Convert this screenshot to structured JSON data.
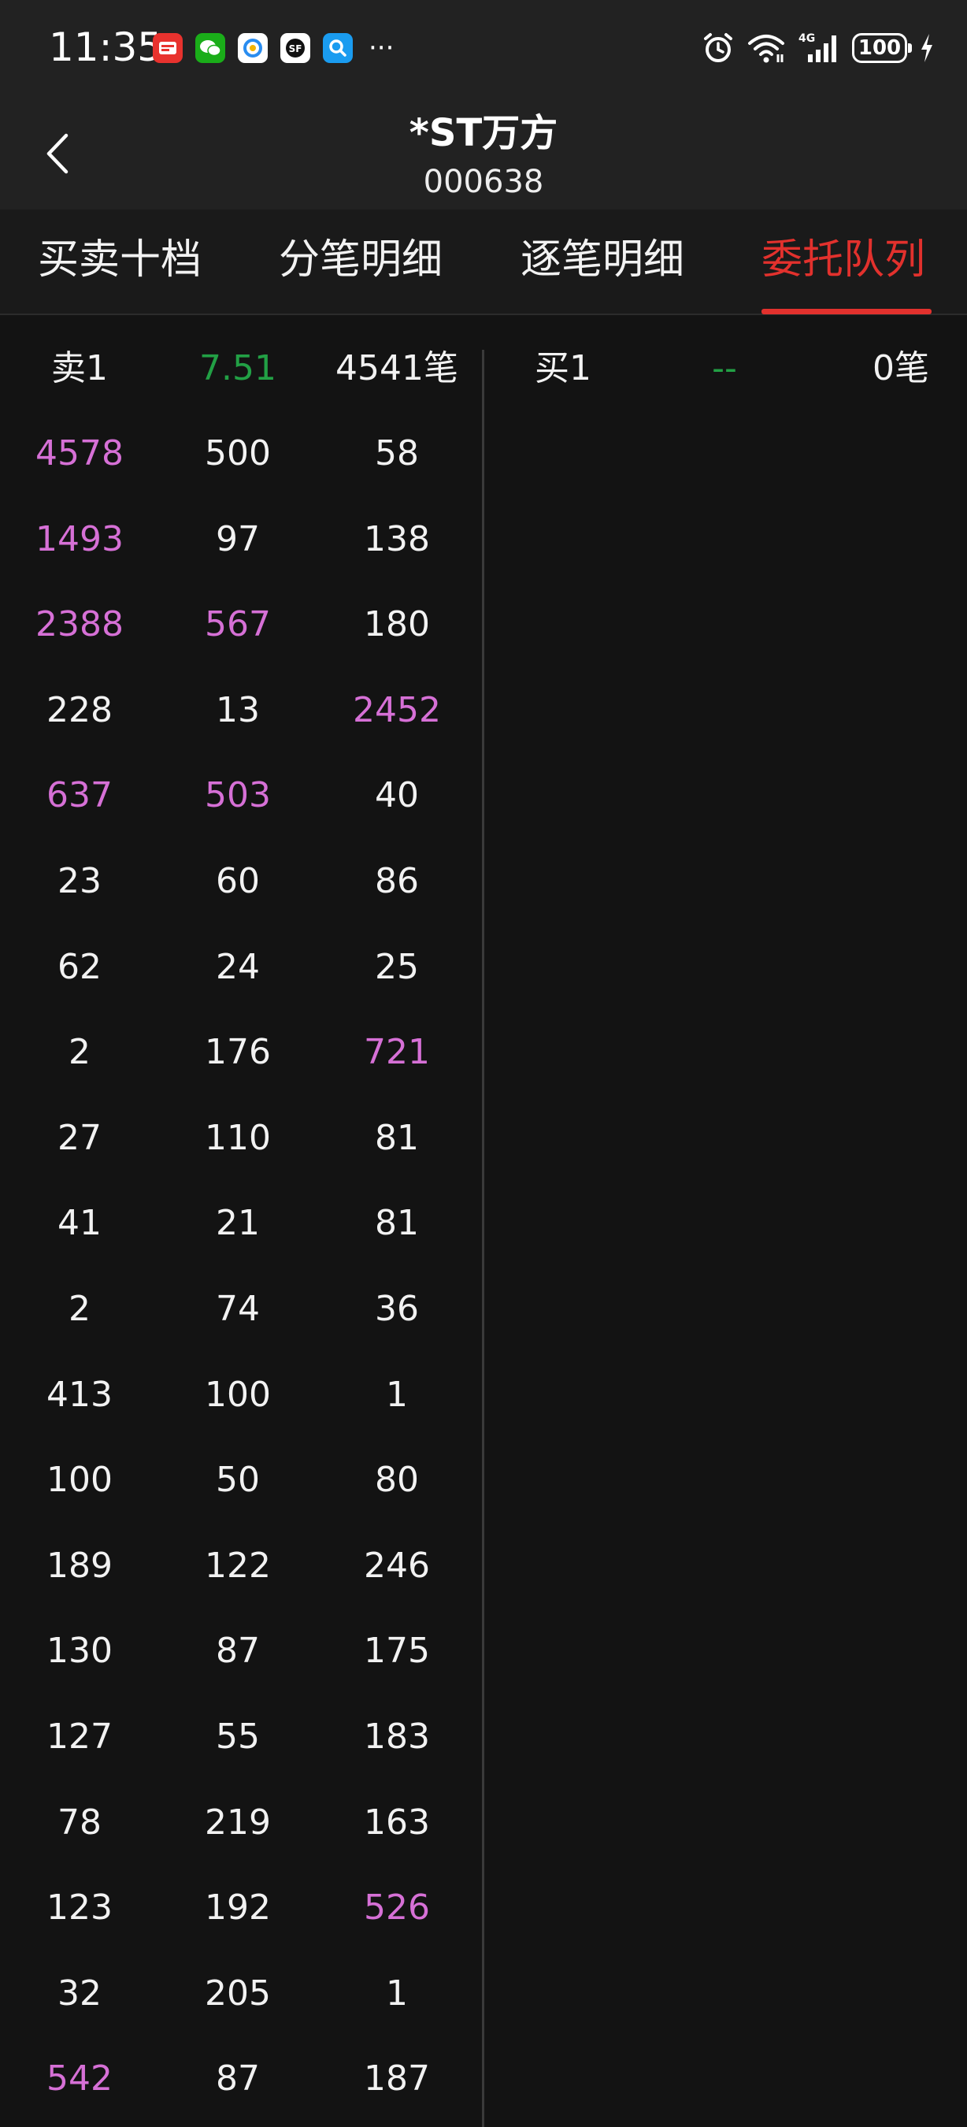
{
  "status_bar": {
    "time": "11:35",
    "notification_icons": [
      "app-icon-red",
      "wechat-icon",
      "qq-browser-icon",
      "sf-express-icon",
      "search-app-icon"
    ],
    "more": "···",
    "battery": "100",
    "network": "4G"
  },
  "header": {
    "stock_name": "*ST万方",
    "stock_code": "000638"
  },
  "tabs": [
    {
      "label": "买卖十档",
      "active": false
    },
    {
      "label": "分笔明细",
      "active": false
    },
    {
      "label": "逐笔明细",
      "active": false
    },
    {
      "label": "委托队列",
      "active": true
    }
  ],
  "sell_queue": {
    "label": "卖1",
    "price": "7.51",
    "count": "4541笔",
    "rows": [
      [
        "4578",
        "500",
        "58"
      ],
      [
        "1493",
        "97",
        "138"
      ],
      [
        "2388",
        "567",
        "180"
      ],
      [
        "228",
        "13",
        "2452"
      ],
      [
        "637",
        "503",
        "40"
      ],
      [
        "23",
        "60",
        "86"
      ],
      [
        "62",
        "24",
        "25"
      ],
      [
        "2",
        "176",
        "721"
      ],
      [
        "27",
        "110",
        "81"
      ],
      [
        "41",
        "21",
        "81"
      ],
      [
        "2",
        "74",
        "36"
      ],
      [
        "413",
        "100",
        "1"
      ],
      [
        "100",
        "50",
        "80"
      ],
      [
        "189",
        "122",
        "246"
      ],
      [
        "130",
        "87",
        "175"
      ],
      [
        "127",
        "55",
        "183"
      ],
      [
        "78",
        "219",
        "163"
      ],
      [
        "123",
        "192",
        "526"
      ],
      [
        "32",
        "205",
        "1"
      ],
      [
        "542",
        "87",
        "187"
      ]
    ],
    "highlighted": [
      [
        true,
        false,
        false
      ],
      [
        true,
        false,
        false
      ],
      [
        true,
        true,
        false
      ],
      [
        false,
        false,
        true
      ],
      [
        true,
        true,
        false
      ],
      [
        false,
        false,
        false
      ],
      [
        false,
        false,
        false
      ],
      [
        false,
        false,
        true
      ],
      [
        false,
        false,
        false
      ],
      [
        false,
        false,
        false
      ],
      [
        false,
        false,
        false
      ],
      [
        false,
        false,
        false
      ],
      [
        false,
        false,
        false
      ],
      [
        false,
        false,
        false
      ],
      [
        false,
        false,
        false
      ],
      [
        false,
        false,
        false
      ],
      [
        false,
        false,
        false
      ],
      [
        false,
        false,
        true
      ],
      [
        false,
        false,
        false
      ],
      [
        true,
        false,
        false
      ]
    ]
  },
  "buy_queue": {
    "label": "买1",
    "price": "--",
    "count": "0笔"
  },
  "colors": {
    "accent": "#e2312d",
    "highlight": "#d670d6",
    "down_green": "#22a045",
    "background": "#131313",
    "header_bg": "#222222"
  }
}
